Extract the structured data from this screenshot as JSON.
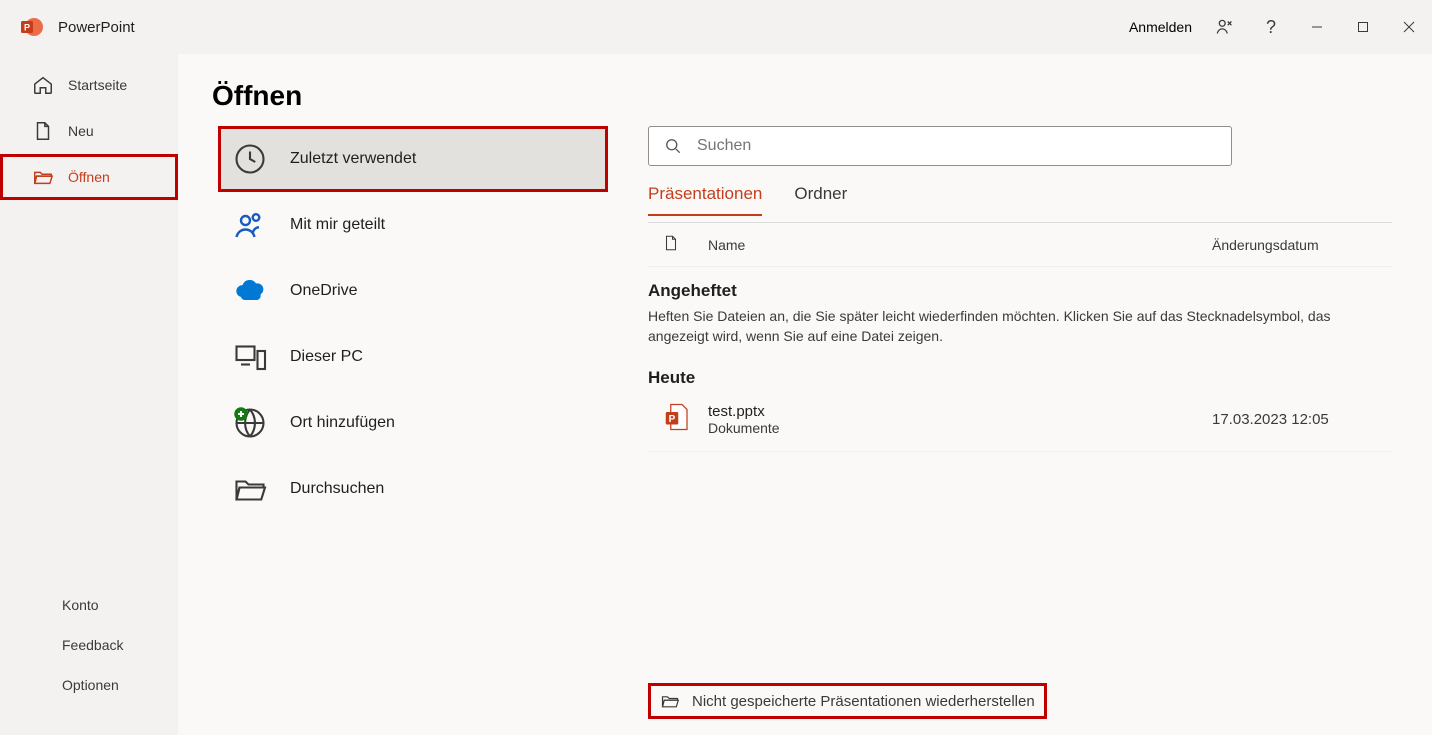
{
  "app": {
    "title": "PowerPoint"
  },
  "titlebar": {
    "signin": "Anmelden"
  },
  "sidebar": {
    "home": "Startseite",
    "new": "Neu",
    "open": "Öffnen",
    "account": "Konto",
    "feedback": "Feedback",
    "options": "Optionen"
  },
  "page": {
    "title": "Öffnen"
  },
  "locations": {
    "recent": "Zuletzt verwendet",
    "shared": "Mit mir geteilt",
    "onedrive": "OneDrive",
    "thispc": "Dieser PC",
    "addplace": "Ort hinzufügen",
    "browse": "Durchsuchen"
  },
  "search": {
    "placeholder": "Suchen"
  },
  "tabs": {
    "presentations": "Präsentationen",
    "folders": "Ordner"
  },
  "list": {
    "headers": {
      "name": "Name",
      "date": "Änderungsdatum"
    },
    "pinned": {
      "title": "Angeheftet",
      "sub": "Heften Sie Dateien an, die Sie später leicht wiederfinden möchten. Klicken Sie auf das Stecknadelsymbol, das angezeigt wird, wenn Sie auf eine Datei zeigen."
    },
    "today": "Heute",
    "files": [
      {
        "name": "test.pptx",
        "path": "Dokumente",
        "date": "17.03.2023 12:05"
      }
    ]
  },
  "recover": "Nicht gespeicherte Präsentationen wiederherstellen"
}
